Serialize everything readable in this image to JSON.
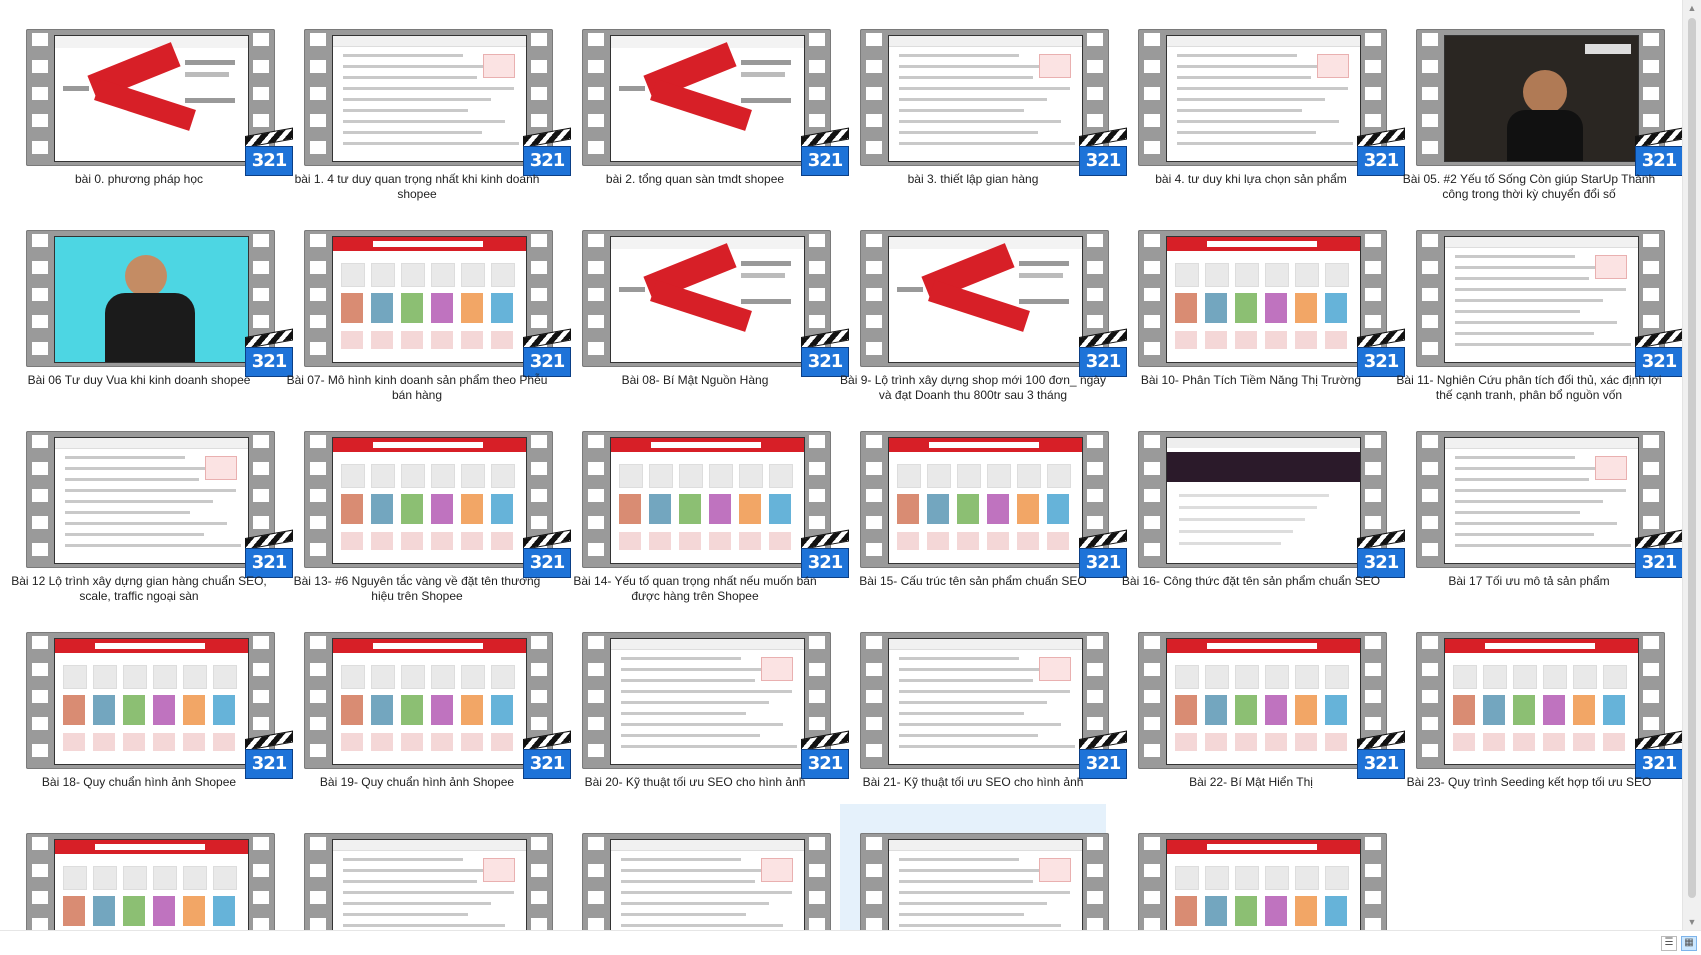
{
  "window": {
    "title": ""
  },
  "colors": {
    "accent": "#d71f27",
    "badge": "#1e73d8",
    "selection": "#e5f1fb"
  },
  "badge_text": "321",
  "videos": [
    {
      "caption": "bài 0. phương pháp học",
      "style": "red"
    },
    {
      "caption": "bài 1. 4 tư duy quan trọng nhất khi kinh doanh shopee",
      "style": "doc"
    },
    {
      "caption": "bài 2. tổng quan sàn tmdt shopee",
      "style": "red"
    },
    {
      "caption": "bài 3. thiết lập gian hàng",
      "style": "doc"
    },
    {
      "caption": "bài 4. tư duy khi lựa chọn sản phẩm",
      "style": "doc"
    },
    {
      "caption": "Bài 05.  #2 Yếu tố Sống Còn giúp StarUp Thành công trong thời kỳ chuyển đổi số",
      "style": "stage"
    },
    {
      "caption": "Bài 06 Tư duy Vua khi kinh doanh shopee",
      "style": "cyan"
    },
    {
      "caption": "Bài 07- Mô hình kinh doanh sản phẩm theo Phễu bán hàng",
      "style": "shop"
    },
    {
      "caption": "Bài 08- Bí Mật Nguồn Hàng",
      "style": "red"
    },
    {
      "caption": "Bài 9- Lộ trình xây dựng shop mới 100 đơn_ ngày và đạt Doanh thu 800tr sau 3 tháng",
      "style": "red"
    },
    {
      "caption": "Bài 10- Phân Tích Tiềm Năng Thị Trường",
      "style": "shop"
    },
    {
      "caption": "Bài 11- Nghiên Cứu phân tích đối thủ, xác định lợi thế cạnh tranh, phân bổ nguồn vốn",
      "style": "doc"
    },
    {
      "caption": "Bài 12 Lộ trình xây dựng gian hàng chuẩn SEO, scale, traffic ngoại sàn",
      "style": "doc"
    },
    {
      "caption": "Bài 13- #6 Nguyên tắc vàng về đặt tên thương hiệu trên Shopee",
      "style": "shop"
    },
    {
      "caption": "Bài 14- Yếu tố quan trọng nhất nếu muốn bán được hàng trên Shopee",
      "style": "shop"
    },
    {
      "caption": "Bài 15- Cấu trúc tên sản phẩm chuẩn SEO",
      "style": "shop"
    },
    {
      "caption": "Bài 16- Công thức đặt tên sản phẩm chuẩn SEO",
      "style": "dark"
    },
    {
      "caption": "Bài 17 Tối ưu mô tả sản phẩm",
      "style": "doc"
    },
    {
      "caption": "Bài 18- Quy chuẩn hình ảnh Shopee",
      "style": "shop"
    },
    {
      "caption": "Bài 19- Quy chuẩn hình ảnh Shopee",
      "style": "shop"
    },
    {
      "caption": "Bài 20- Kỹ thuật tối ưu SEO cho hình ảnh",
      "style": "doc"
    },
    {
      "caption": "Bài 21- Kỹ thuật tối ưu SEO cho hình ảnh",
      "style": "doc"
    },
    {
      "caption": "Bài 22- Bí Mật Hiển Thị",
      "style": "shop"
    },
    {
      "caption": "Bài 23- Quy trình Seeding kết hợp tối ưu SEO",
      "style": "shop"
    },
    {
      "caption": "",
      "style": "shop"
    },
    {
      "caption": "",
      "style": "doc"
    },
    {
      "caption": "",
      "style": "doc"
    },
    {
      "caption": "",
      "style": "doc",
      "selected": true
    },
    {
      "caption": "",
      "style": "shop"
    }
  ],
  "statusbar": {
    "view_details_icon": "details-view-icon",
    "view_large_icon": "large-icons-view-icon"
  }
}
